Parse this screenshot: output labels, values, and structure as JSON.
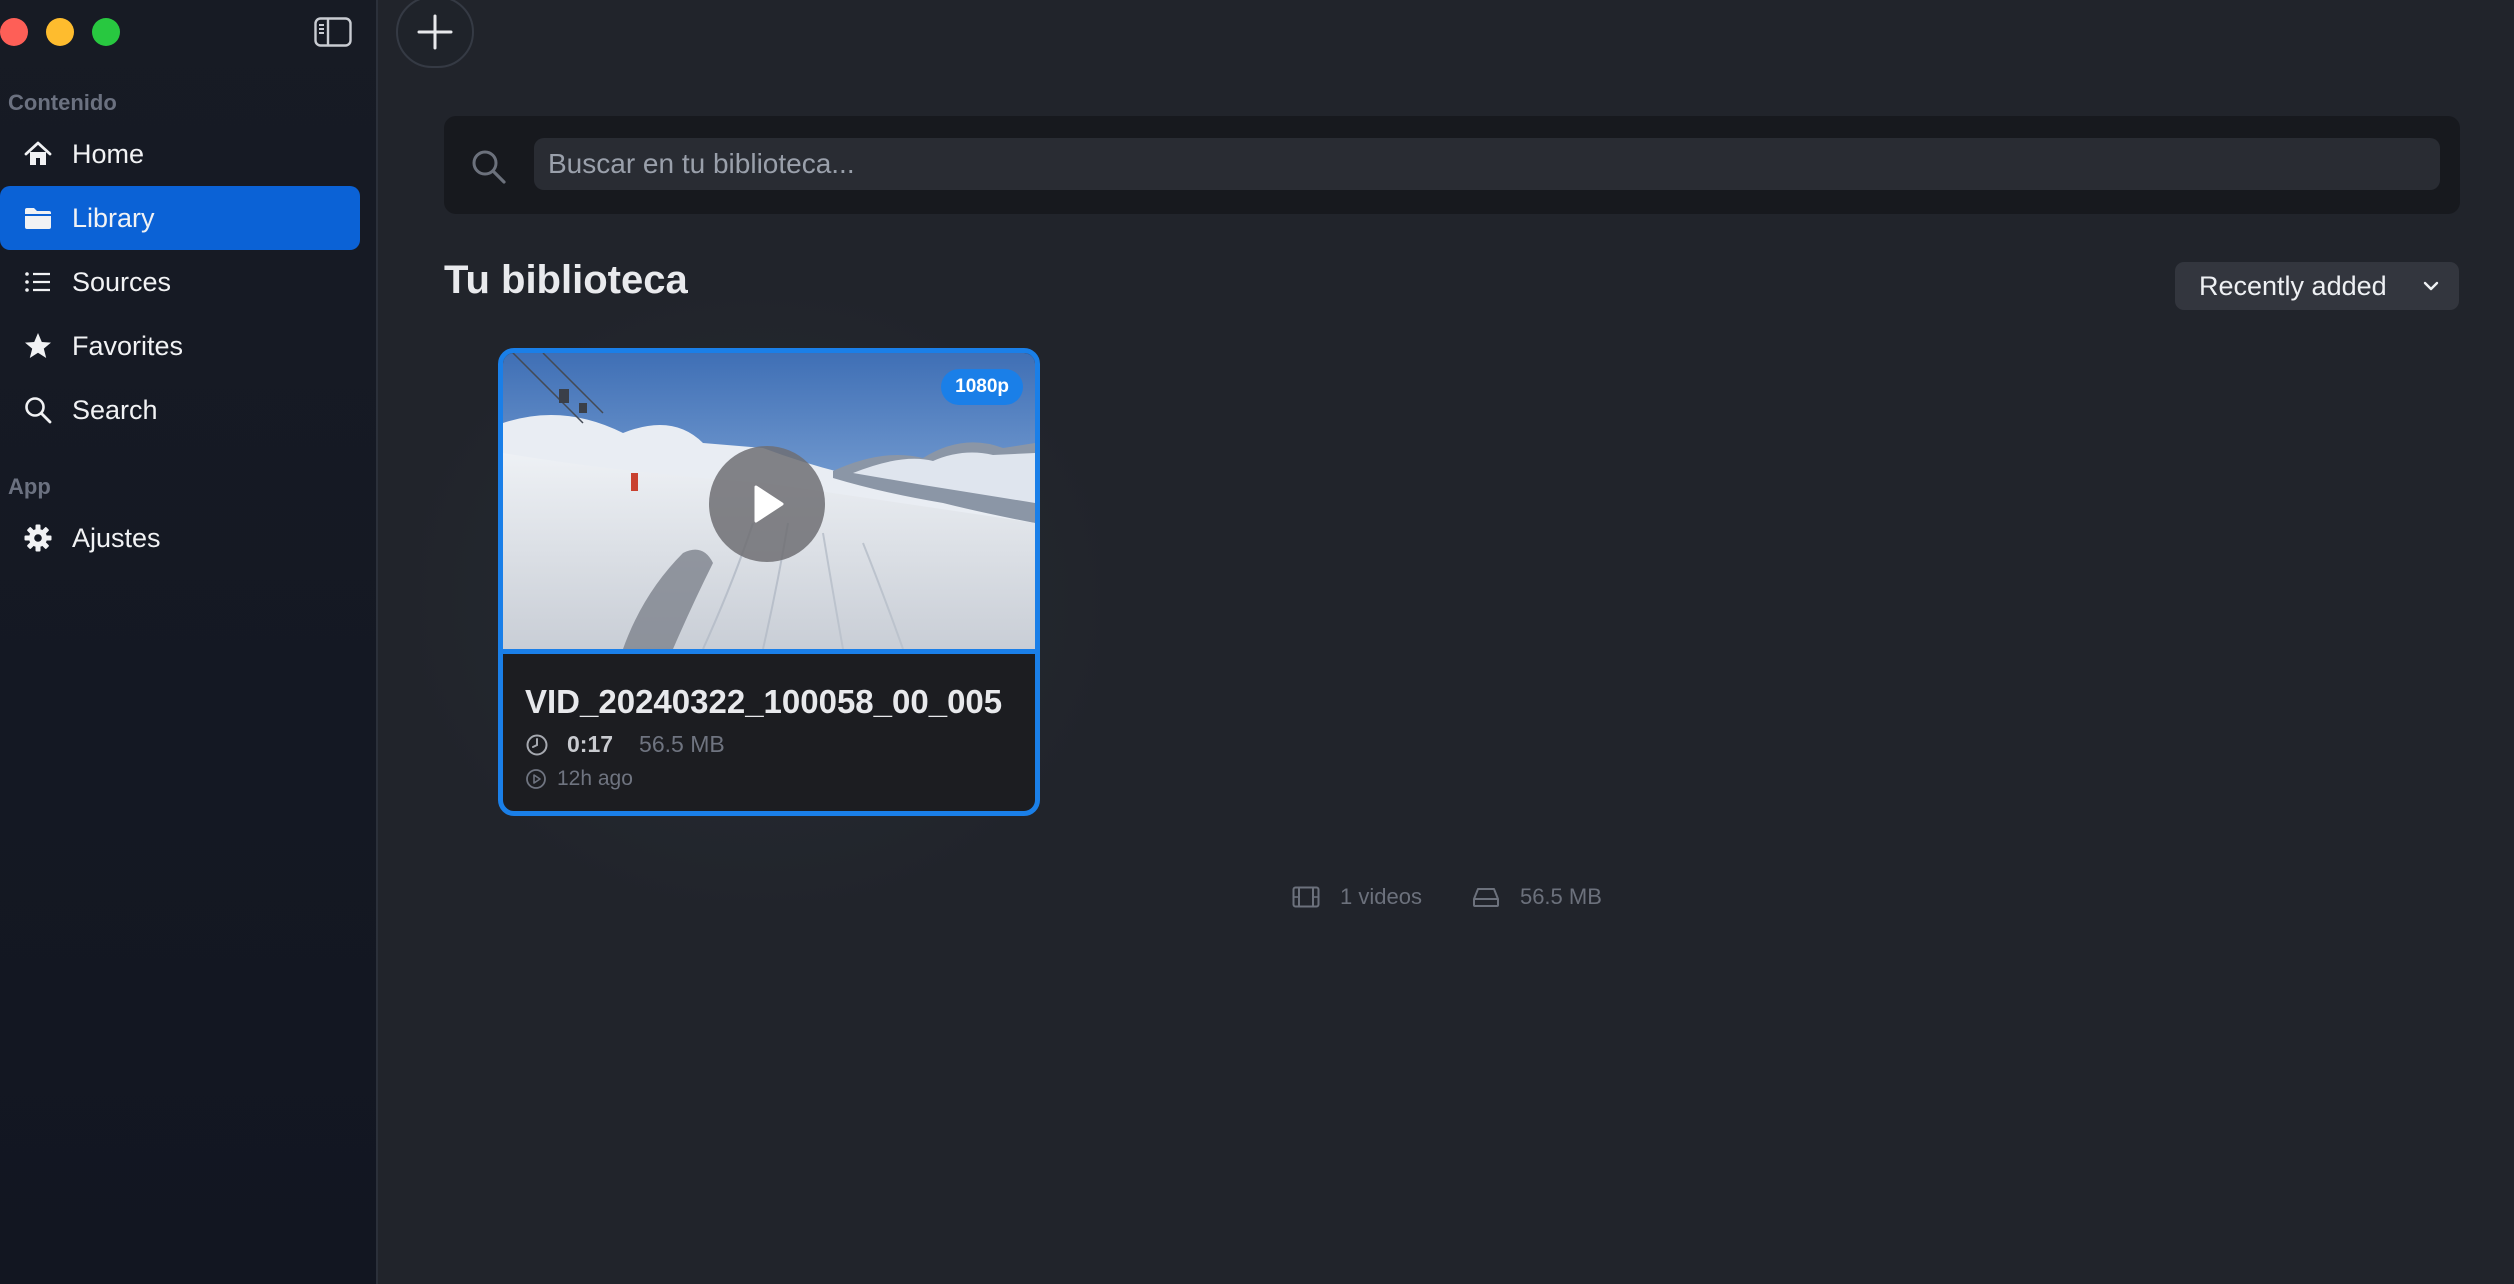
{
  "window": {
    "sidebar_toggle_icon": "sidebar-toggle-icon",
    "add_icon": "plus-icon"
  },
  "sidebar": {
    "sections": [
      {
        "label": "Contenido",
        "items": [
          {
            "label": "Home",
            "icon": "home-icon",
            "active": false
          },
          {
            "label": "Library",
            "icon": "folder-icon",
            "active": true
          },
          {
            "label": "Sources",
            "icon": "list-icon",
            "active": false
          },
          {
            "label": "Favorites",
            "icon": "star-icon",
            "active": false
          },
          {
            "label": "Search",
            "icon": "search-icon",
            "active": false
          }
        ]
      },
      {
        "label": "App",
        "items": [
          {
            "label": "Ajustes",
            "icon": "gear-icon",
            "active": false
          }
        ]
      }
    ]
  },
  "search": {
    "placeholder": "Buscar en tu biblioteca..."
  },
  "library": {
    "title": "Tu biblioteca",
    "sort": {
      "selected": "Recently added"
    }
  },
  "videos": [
    {
      "title": "VID_20240322_100058_00_005",
      "resolution": "1080p",
      "duration": "0:17",
      "size": "56.5 MB",
      "added": "12h ago"
    }
  ],
  "stats": {
    "videos": "1 videos",
    "storage": "56.5 MB"
  },
  "colors": {
    "accent": "#1a7fe8",
    "active_nav": "#0b62d6",
    "background": "#21242b",
    "sidebar": "#161a23"
  }
}
